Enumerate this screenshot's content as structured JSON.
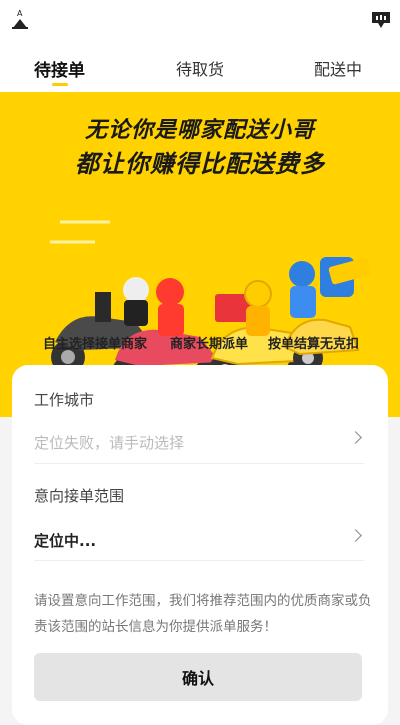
{
  "header": {
    "left_icon": "app-logo-icon",
    "right_icon": "chat-icon"
  },
  "tabs": [
    {
      "label": "待接单",
      "active": true
    },
    {
      "label": "待取货",
      "active": false
    },
    {
      "label": "配送中",
      "active": false
    }
  ],
  "banner": {
    "headline_1": "无论你是哪家配送小哥",
    "headline_2": "都让你赚得比配送费多",
    "features": [
      "自主选择接单商家",
      "商家长期派单",
      "按单结算无克扣"
    ],
    "colors": {
      "background": "#ffd200",
      "accent": "#ff3b30"
    }
  },
  "form": {
    "city_label": "工作城市",
    "city_placeholder": "定位失败，请手动选择",
    "range_label": "意向接单范围",
    "range_value": "定位中...",
    "hint": "请设置意向工作范围，我们将推荐范围内的优质商家或负责该范围的站长信息为你提供派单服务！",
    "confirm_label": "确认"
  }
}
